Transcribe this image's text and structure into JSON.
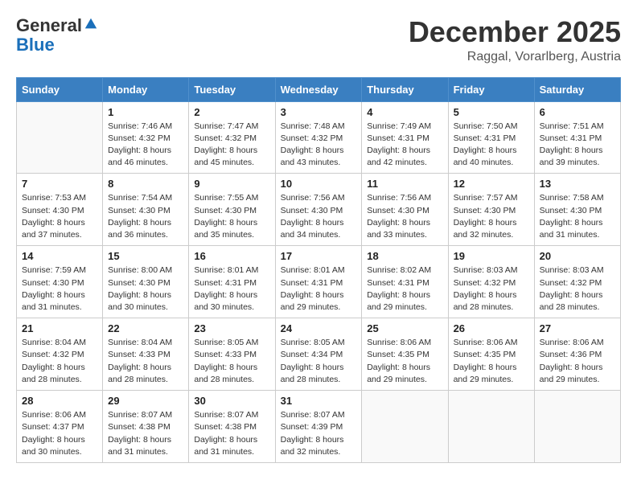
{
  "header": {
    "logo_general": "General",
    "logo_blue": "Blue",
    "month_title": "December 2025",
    "location": "Raggal, Vorarlberg, Austria"
  },
  "days_of_week": [
    "Sunday",
    "Monday",
    "Tuesday",
    "Wednesday",
    "Thursday",
    "Friday",
    "Saturday"
  ],
  "weeks": [
    [
      {
        "day": "",
        "info": ""
      },
      {
        "day": "1",
        "info": "Sunrise: 7:46 AM\nSunset: 4:32 PM\nDaylight: 8 hours\nand 46 minutes."
      },
      {
        "day": "2",
        "info": "Sunrise: 7:47 AM\nSunset: 4:32 PM\nDaylight: 8 hours\nand 45 minutes."
      },
      {
        "day": "3",
        "info": "Sunrise: 7:48 AM\nSunset: 4:32 PM\nDaylight: 8 hours\nand 43 minutes."
      },
      {
        "day": "4",
        "info": "Sunrise: 7:49 AM\nSunset: 4:31 PM\nDaylight: 8 hours\nand 42 minutes."
      },
      {
        "day": "5",
        "info": "Sunrise: 7:50 AM\nSunset: 4:31 PM\nDaylight: 8 hours\nand 40 minutes."
      },
      {
        "day": "6",
        "info": "Sunrise: 7:51 AM\nSunset: 4:31 PM\nDaylight: 8 hours\nand 39 minutes."
      }
    ],
    [
      {
        "day": "7",
        "info": "Sunrise: 7:53 AM\nSunset: 4:30 PM\nDaylight: 8 hours\nand 37 minutes."
      },
      {
        "day": "8",
        "info": "Sunrise: 7:54 AM\nSunset: 4:30 PM\nDaylight: 8 hours\nand 36 minutes."
      },
      {
        "day": "9",
        "info": "Sunrise: 7:55 AM\nSunset: 4:30 PM\nDaylight: 8 hours\nand 35 minutes."
      },
      {
        "day": "10",
        "info": "Sunrise: 7:56 AM\nSunset: 4:30 PM\nDaylight: 8 hours\nand 34 minutes."
      },
      {
        "day": "11",
        "info": "Sunrise: 7:56 AM\nSunset: 4:30 PM\nDaylight: 8 hours\nand 33 minutes."
      },
      {
        "day": "12",
        "info": "Sunrise: 7:57 AM\nSunset: 4:30 PM\nDaylight: 8 hours\nand 32 minutes."
      },
      {
        "day": "13",
        "info": "Sunrise: 7:58 AM\nSunset: 4:30 PM\nDaylight: 8 hours\nand 31 minutes."
      }
    ],
    [
      {
        "day": "14",
        "info": "Sunrise: 7:59 AM\nSunset: 4:30 PM\nDaylight: 8 hours\nand 31 minutes."
      },
      {
        "day": "15",
        "info": "Sunrise: 8:00 AM\nSunset: 4:30 PM\nDaylight: 8 hours\nand 30 minutes."
      },
      {
        "day": "16",
        "info": "Sunrise: 8:01 AM\nSunset: 4:31 PM\nDaylight: 8 hours\nand 30 minutes."
      },
      {
        "day": "17",
        "info": "Sunrise: 8:01 AM\nSunset: 4:31 PM\nDaylight: 8 hours\nand 29 minutes."
      },
      {
        "day": "18",
        "info": "Sunrise: 8:02 AM\nSunset: 4:31 PM\nDaylight: 8 hours\nand 29 minutes."
      },
      {
        "day": "19",
        "info": "Sunrise: 8:03 AM\nSunset: 4:32 PM\nDaylight: 8 hours\nand 28 minutes."
      },
      {
        "day": "20",
        "info": "Sunrise: 8:03 AM\nSunset: 4:32 PM\nDaylight: 8 hours\nand 28 minutes."
      }
    ],
    [
      {
        "day": "21",
        "info": "Sunrise: 8:04 AM\nSunset: 4:32 PM\nDaylight: 8 hours\nand 28 minutes."
      },
      {
        "day": "22",
        "info": "Sunrise: 8:04 AM\nSunset: 4:33 PM\nDaylight: 8 hours\nand 28 minutes."
      },
      {
        "day": "23",
        "info": "Sunrise: 8:05 AM\nSunset: 4:33 PM\nDaylight: 8 hours\nand 28 minutes."
      },
      {
        "day": "24",
        "info": "Sunrise: 8:05 AM\nSunset: 4:34 PM\nDaylight: 8 hours\nand 28 minutes."
      },
      {
        "day": "25",
        "info": "Sunrise: 8:06 AM\nSunset: 4:35 PM\nDaylight: 8 hours\nand 29 minutes."
      },
      {
        "day": "26",
        "info": "Sunrise: 8:06 AM\nSunset: 4:35 PM\nDaylight: 8 hours\nand 29 minutes."
      },
      {
        "day": "27",
        "info": "Sunrise: 8:06 AM\nSunset: 4:36 PM\nDaylight: 8 hours\nand 29 minutes."
      }
    ],
    [
      {
        "day": "28",
        "info": "Sunrise: 8:06 AM\nSunset: 4:37 PM\nDaylight: 8 hours\nand 30 minutes."
      },
      {
        "day": "29",
        "info": "Sunrise: 8:07 AM\nSunset: 4:38 PM\nDaylight: 8 hours\nand 31 minutes."
      },
      {
        "day": "30",
        "info": "Sunrise: 8:07 AM\nSunset: 4:38 PM\nDaylight: 8 hours\nand 31 minutes."
      },
      {
        "day": "31",
        "info": "Sunrise: 8:07 AM\nSunset: 4:39 PM\nDaylight: 8 hours\nand 32 minutes."
      },
      {
        "day": "",
        "info": ""
      },
      {
        "day": "",
        "info": ""
      },
      {
        "day": "",
        "info": ""
      }
    ]
  ]
}
